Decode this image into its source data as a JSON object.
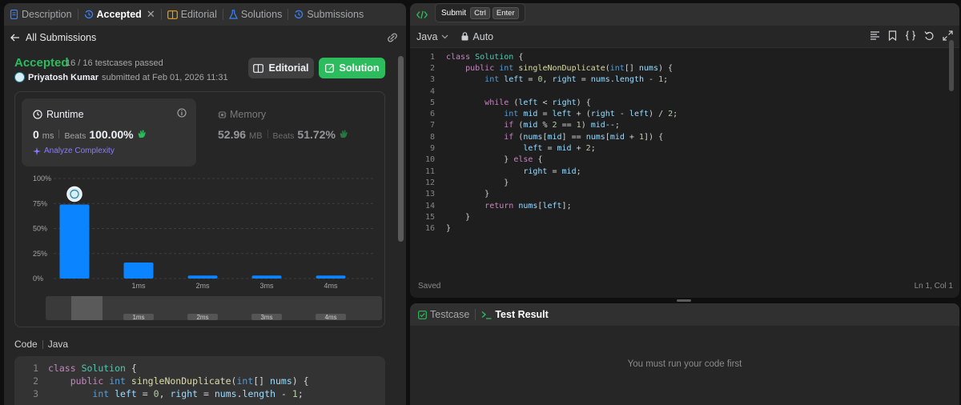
{
  "left": {
    "tabs": [
      {
        "label": "Description",
        "icon": "document-icon"
      },
      {
        "label": "Accepted",
        "icon": "history-icon",
        "active": true
      },
      {
        "label": "Editorial",
        "icon": "book-icon"
      },
      {
        "label": "Solutions",
        "icon": "flask-icon"
      },
      {
        "label": "Submissions",
        "icon": "history-icon"
      }
    ],
    "back_label": "All Submissions",
    "status": "Accepted",
    "testcases": "16 / 16 testcases passed",
    "submitter": "Priyatosh Kumar",
    "submitted_at": "submitted at Feb 01, 2026 11:31",
    "editorial_label": "Editorial",
    "solution_label": "Solution",
    "runtime": {
      "label": "Runtime",
      "value": "0",
      "unit": "ms",
      "beats_label": "Beats",
      "beats_value": "100.00%",
      "analyze_label": "Analyze Complexity"
    },
    "memory": {
      "label": "Memory",
      "value": "52.96",
      "unit": "MB",
      "beats_label": "Beats",
      "beats_value": "51.72%"
    },
    "code_heading": "Code",
    "code_language": "Java",
    "code_preview": [
      {
        "n": "1",
        "text": "class Solution {"
      },
      {
        "n": "2",
        "text": "    public int singleNonDuplicate(int[] nums) {"
      },
      {
        "n": "3",
        "text": "        int left = 0, right = nums.length - 1;"
      }
    ]
  },
  "chart_data": {
    "type": "bar",
    "title": "",
    "xlabel": "",
    "ylabel": "",
    "y_ticks": [
      "100%",
      "75%",
      "50%",
      "25%",
      "0%"
    ],
    "ylim": [
      0,
      100
    ],
    "categories": [
      "0ms",
      "1ms",
      "2ms",
      "3ms",
      "4ms"
    ],
    "x_tick_labels": [
      "",
      "1ms",
      "2ms",
      "3ms",
      "4ms"
    ],
    "values": [
      74,
      16,
      3,
      3,
      3
    ],
    "highlighted_category": "0ms",
    "bar_color": "#0a84ff",
    "grid": true,
    "grid_style": "dashed",
    "overview_labels": [
      "1ms",
      "2ms",
      "3ms",
      "4ms"
    ]
  },
  "editor": {
    "tooltip": {
      "label": "Submit",
      "keys": [
        "Ctrl",
        "Enter"
      ]
    },
    "language": "Java",
    "mode": "Auto",
    "toolbar_icons": [
      "format-icon",
      "bookmark-icon",
      "braces-icon",
      "undo-icon",
      "fullscreen-icon"
    ],
    "lines": [
      {
        "n": "1",
        "code": "class Solution {"
      },
      {
        "n": "2",
        "code": "    public int singleNonDuplicate(int[] nums) {"
      },
      {
        "n": "3",
        "code": "        int left = 0, right = nums.length - 1;"
      },
      {
        "n": "4",
        "code": ""
      },
      {
        "n": "5",
        "code": "        while (left < right) {"
      },
      {
        "n": "6",
        "code": "            int mid = left + (right - left) / 2;"
      },
      {
        "n": "7",
        "code": "            if (mid % 2 == 1) mid--;"
      },
      {
        "n": "8",
        "code": "            if (nums[mid] == nums[mid + 1]) {"
      },
      {
        "n": "9",
        "code": "                left = mid + 2;"
      },
      {
        "n": "10",
        "code": "            } else {"
      },
      {
        "n": "11",
        "code": "                right = mid;"
      },
      {
        "n": "12",
        "code": "            }"
      },
      {
        "n": "13",
        "code": "        }"
      },
      {
        "n": "14",
        "code": "        return nums[left];"
      },
      {
        "n": "15",
        "code": "    }"
      },
      {
        "n": "16",
        "code": "}"
      }
    ],
    "saved_label": "Saved",
    "cursor_position": "Ln 1, Col 1"
  },
  "result": {
    "tabs": [
      {
        "label": "Testcase",
        "icon": "checkbox-icon"
      },
      {
        "label": "Test Result",
        "icon": "terminal-icon",
        "active": true
      }
    ],
    "empty_message": "You must run your code first"
  },
  "colors": {
    "accent_green": "#2cbb5d",
    "bar_blue": "#0a84ff",
    "keyword": "#c586c0",
    "type": "#4ec9b0",
    "function": "#dcdcaa",
    "variable": "#9cdcfe",
    "number": "#b5cea8"
  }
}
